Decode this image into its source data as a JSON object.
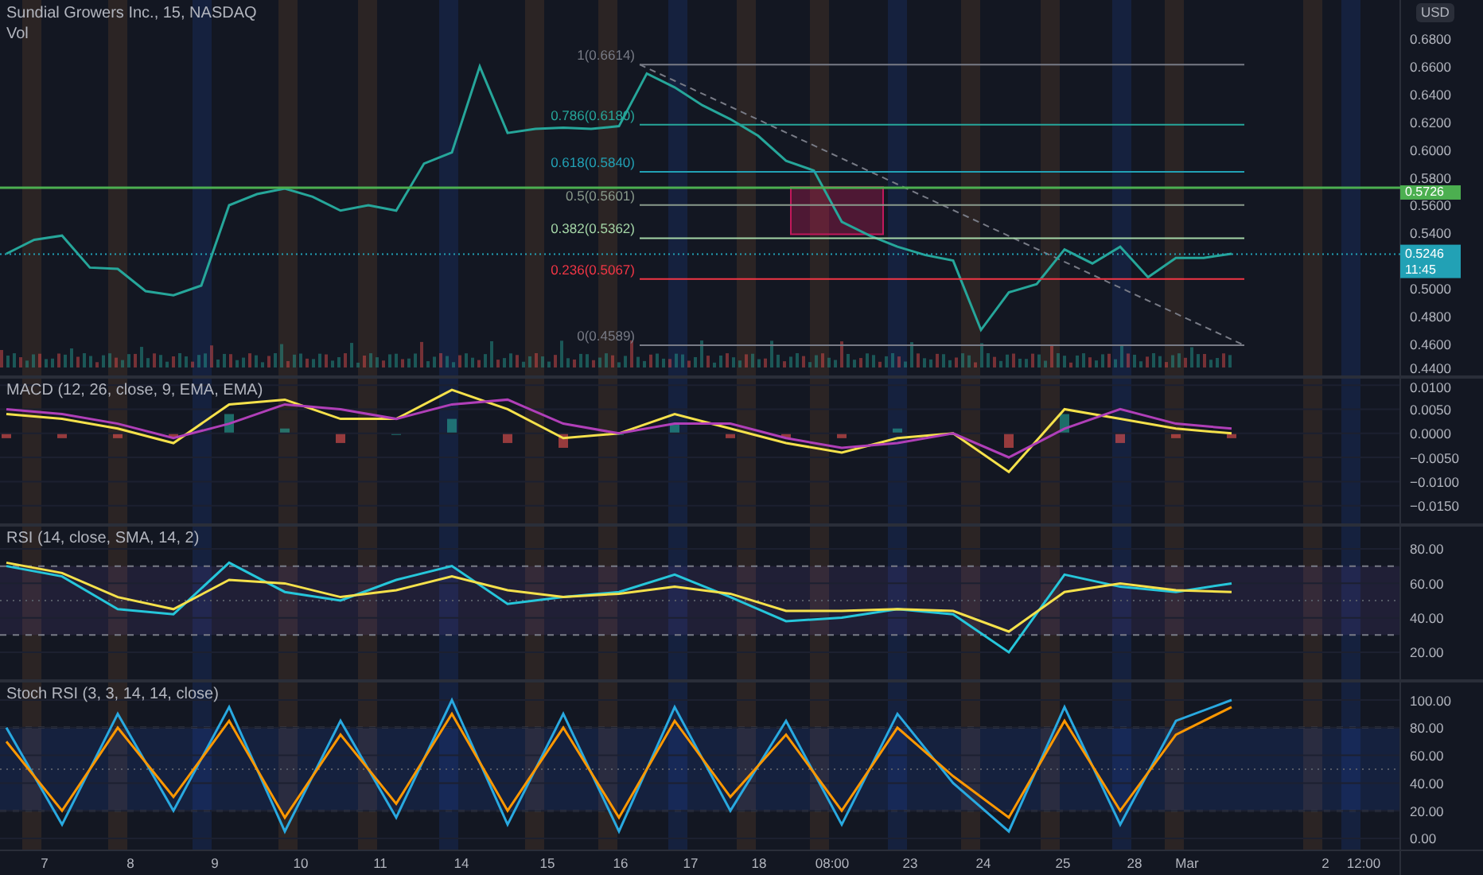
{
  "header": {
    "title": "Sundial Growers Inc., 15, NASDAQ",
    "volume_label": "Vol"
  },
  "price_pane": {
    "currency": "USD",
    "countdown": "11:45",
    "chart_data": {
      "type": "line",
      "series": [
        {
          "color": "#26a69a",
          "values": [
            0.525,
            0.535,
            0.538,
            0.515,
            0.514,
            0.498,
            0.495,
            0.502,
            0.56,
            0.568,
            0.572,
            0.566,
            0.556,
            0.56,
            0.556,
            0.59,
            0.598,
            0.66,
            0.612,
            0.615,
            0.616,
            0.615,
            0.617,
            0.655,
            0.645,
            0.632,
            0.622,
            0.61,
            0.592,
            0.585,
            0.548,
            0.538,
            0.53,
            0.524,
            0.52,
            0.47,
            0.497,
            0.503,
            0.528,
            0.518,
            0.53,
            0.508,
            0.522,
            0.522,
            0.525
          ]
        }
      ],
      "ylim": [
        0.436,
        0.708
      ],
      "yticks": [
        {
          "value": 0.68,
          "label": "0.6800"
        },
        {
          "value": 0.66,
          "label": "0.6600"
        },
        {
          "value": 0.64,
          "label": "0.6400"
        },
        {
          "value": 0.62,
          "label": "0.6200"
        },
        {
          "value": 0.6,
          "label": "0.6000"
        },
        {
          "value": 0.58,
          "label": "0.5800"
        },
        {
          "value": 0.56,
          "label": "0.5600"
        },
        {
          "value": 0.54,
          "label": "0.5400"
        },
        {
          "value": 0.5,
          "label": "0.5000"
        },
        {
          "value": 0.48,
          "label": "0.4800"
        },
        {
          "value": 0.46,
          "label": "0.4600"
        },
        {
          "value": 0.44,
          "label": "0.4400"
        }
      ],
      "ref_lines": [
        {
          "axis": "y",
          "value": 0.6614,
          "label": "1(0.6614)",
          "color": "#787b86"
        },
        {
          "axis": "y",
          "value": 0.618,
          "label": "0.786(0.6180)",
          "color": "#26a69a"
        },
        {
          "axis": "y",
          "value": 0.584,
          "label": "0.618(0.5840)",
          "color": "#22a1b5"
        },
        {
          "axis": "y",
          "value": 0.5601,
          "label": "0.5(0.5601)",
          "color": "#8a9a8c"
        },
        {
          "axis": "y",
          "value": 0.5362,
          "label": "0.382(0.5362)",
          "color": "#a5d6a7"
        },
        {
          "axis": "y",
          "value": 0.5067,
          "label": "0.236(0.5067)",
          "color": "#f23645"
        },
        {
          "axis": "y",
          "value": 0.4589,
          "label": "0(0.4589)",
          "color": "#787b86"
        },
        {
          "axis": "y",
          "value": 0.5726,
          "label": "0.5726",
          "color": "#4caf50"
        },
        {
          "axis": "y",
          "value": 0.5246,
          "label": "0.5246",
          "color": "#22a1b5"
        }
      ]
    }
  },
  "macd_pane": {
    "legend": "MACD (12, 26, close, 9, EMA, EMA)",
    "chart_data": {
      "type": "line",
      "grid": true,
      "series": [
        {
          "color": "#f5e14b",
          "values": [
            0.004,
            0.003,
            0.001,
            -0.002,
            0.006,
            0.007,
            0.003,
            0.003,
            0.009,
            0.005,
            -0.001,
            0.0,
            0.004,
            0.001,
            -0.002,
            -0.004,
            -0.001,
            0.0,
            -0.008,
            0.005,
            0.003,
            0.001,
            0.0
          ]
        },
        {
          "color": "#b03fb8",
          "values": [
            0.005,
            0.004,
            0.002,
            -0.001,
            0.002,
            0.006,
            0.005,
            0.003,
            0.006,
            0.007,
            0.002,
            0.0,
            0.002,
            0.002,
            -0.001,
            -0.003,
            -0.002,
            0.0,
            -0.005,
            0.001,
            0.005,
            0.002,
            0.001
          ]
        }
      ],
      "ylim": [
        -0.019,
        0.01167
      ],
      "yticks": [
        {
          "value": 0.01,
          "label": "0.0100"
        },
        {
          "value": 0.005,
          "label": "0.0050"
        },
        {
          "value": 0,
          "label": "0.0000"
        },
        {
          "value": -0.005,
          "label": "−0.0050"
        },
        {
          "value": -0.01,
          "label": "−0.0100"
        },
        {
          "value": -0.015,
          "label": "−0.0150"
        }
      ]
    }
  },
  "rsi_pane": {
    "legend": "RSI (14, close, SMA, 14, 2)",
    "chart_data": {
      "type": "line",
      "grid": true,
      "series": [
        {
          "color": "#26c6da",
          "values": [
            70,
            64,
            45,
            42,
            72,
            55,
            50,
            62,
            70,
            48,
            52,
            55,
            65,
            52,
            38,
            40,
            45,
            42,
            20,
            65,
            58,
            55,
            60
          ]
        },
        {
          "color": "#f5e14b",
          "values": [
            72,
            66,
            52,
            45,
            62,
            60,
            52,
            56,
            64,
            56,
            52,
            54,
            58,
            54,
            44,
            44,
            45,
            44,
            32,
            55,
            60,
            56,
            55
          ]
        }
      ],
      "ylim": [
        3.35,
        93.85
      ],
      "yticks": [
        {
          "value": 80,
          "label": "80.00"
        },
        {
          "value": 60,
          "label": "60.00"
        },
        {
          "value": 40,
          "label": "40.00"
        },
        {
          "value": 20,
          "label": "20.00"
        }
      ]
    }
  },
  "stoch_pane": {
    "legend": "Stoch RSI (3, 3, 14, 14, close)",
    "chart_data": {
      "type": "line",
      "grid": true,
      "series": [
        {
          "color": "#29a9e0",
          "values": [
            80,
            10,
            90,
            20,
            95,
            5,
            85,
            15,
            100,
            10,
            90,
            5,
            95,
            20,
            85,
            10,
            90,
            40,
            5,
            95,
            10,
            85,
            100
          ]
        },
        {
          "color": "#ff9800",
          "values": [
            70,
            20,
            80,
            30,
            85,
            15,
            75,
            25,
            90,
            20,
            80,
            15,
            85,
            30,
            75,
            20,
            80,
            45,
            15,
            85,
            20,
            75,
            95
          ]
        }
      ],
      "ylim": [
        -9.2,
        113.8
      ],
      "yticks": [
        {
          "value": 100,
          "label": "100.00"
        },
        {
          "value": 80,
          "label": "80.00"
        },
        {
          "value": 60,
          "label": "60.00"
        },
        {
          "value": 40,
          "label": "40.00"
        },
        {
          "value": 20,
          "label": "20.00"
        },
        {
          "value": 0,
          "label": "0.00"
        }
      ]
    }
  },
  "time_axis": {
    "labels": [
      "7",
      "8",
      "9",
      "10",
      "11",
      "14",
      "15",
      "16",
      "17",
      "18",
      "08:00",
      "23",
      "24",
      "25",
      "28",
      "Mar",
      "2",
      "12:00"
    ]
  }
}
